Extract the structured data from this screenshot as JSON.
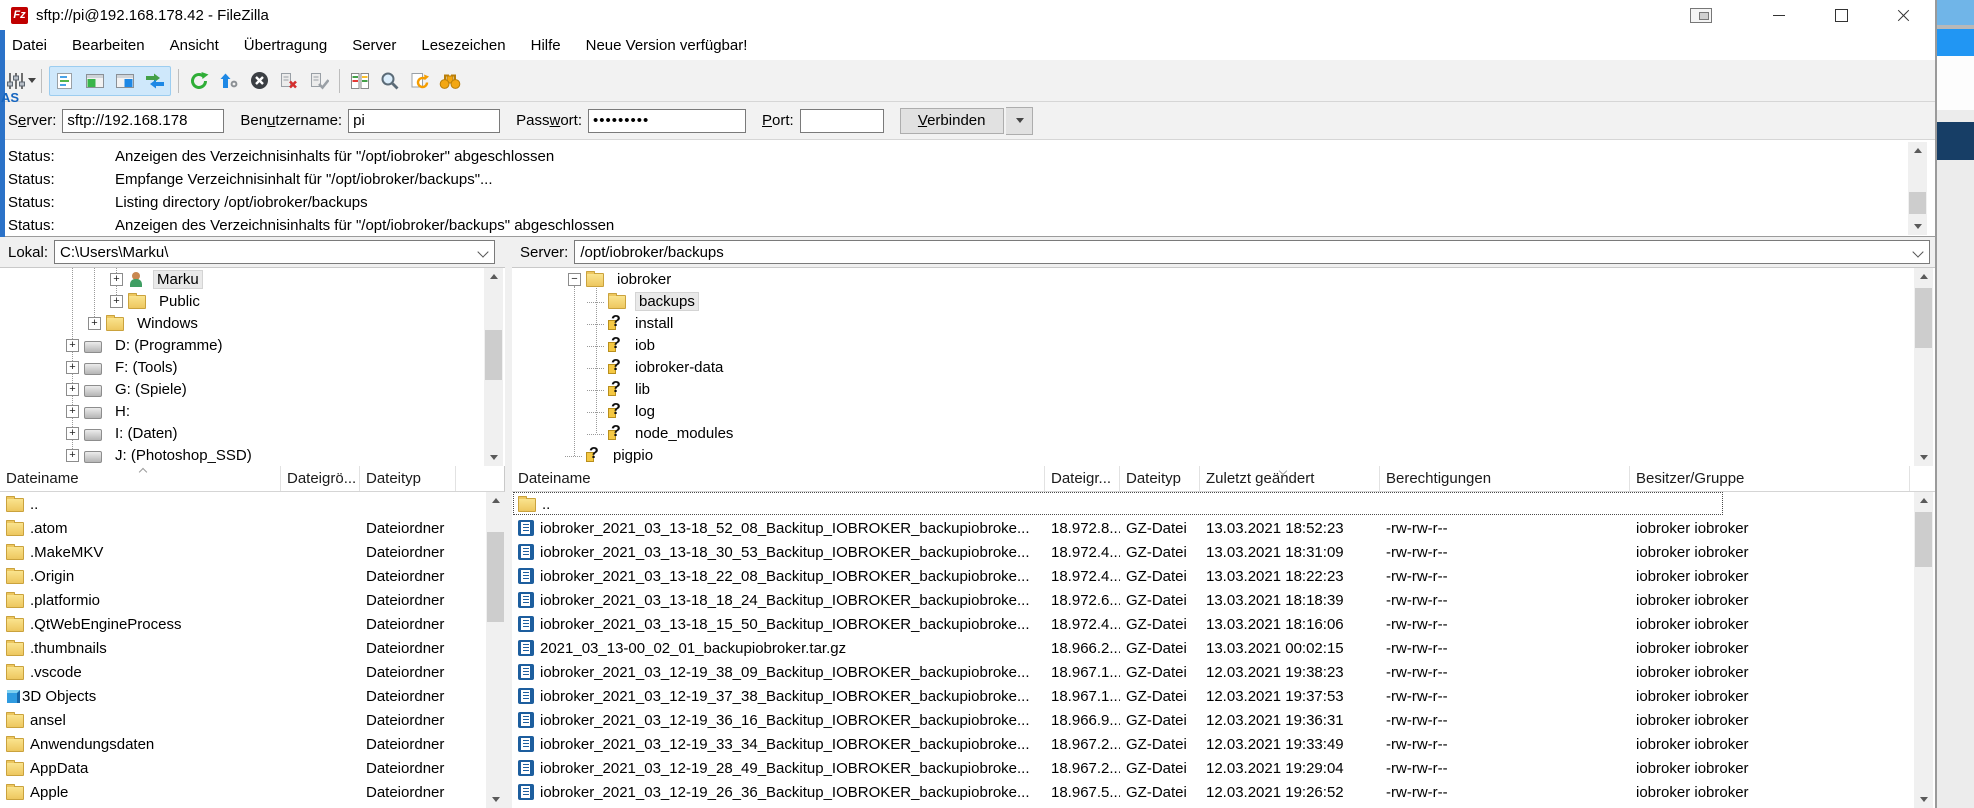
{
  "window": {
    "title": "sftp://pi@192.168.178.42 - FileZilla",
    "logo_text": "Fz"
  },
  "background": {
    "fragment_text": "AS"
  },
  "menu": {
    "items": [
      "Datei",
      "Bearbeiten",
      "Ansicht",
      "Übertragung",
      "Server",
      "Lesezeichen",
      "Hilfe",
      "Neue Version verfügbar!"
    ]
  },
  "toolbar": {
    "icons": [
      "site-manager",
      "toggle-message-log",
      "toggle-local-tree",
      "toggle-remote-tree",
      "toggle-transfer-queue",
      "refresh",
      "process-queue",
      "cancel-transfer",
      "disconnect",
      "reconnect",
      "directory-comparison",
      "synchronized-browsing",
      "refresh-directory-listing",
      "file-search"
    ]
  },
  "quickconnect": {
    "server_label_pre": "S",
    "server_label_key": "e",
    "server_label_post": "rver:",
    "server_value": "sftp://192.168.178",
    "user_label_pre": "Ben",
    "user_label_key": "u",
    "user_label_post": "tzername:",
    "user_value": "pi",
    "pass_label_pre": "Pass",
    "pass_label_key": "w",
    "pass_label_post": "ort:",
    "pass_value": "•••••••••",
    "port_label_pre": "",
    "port_label_key": "P",
    "port_label_post": "ort:",
    "port_value": "",
    "connect_key": "V",
    "connect_rest": "erbinden"
  },
  "status_log": [
    {
      "label": "Status:",
      "message": "Anzeigen des Verzeichnisinhalts für \"/opt/iobroker\" abgeschlossen"
    },
    {
      "label": "Status:",
      "message": "Empfange Verzeichnisinhalt für \"/opt/iobroker/backups\"..."
    },
    {
      "label": "Status:",
      "message": "Listing directory /opt/iobroker/backups"
    },
    {
      "label": "Status:",
      "message": "Anzeigen des Verzeichnisinhalts für \"/opt/iobroker/backups\" abgeschlossen"
    }
  ],
  "local": {
    "path_label": "Lokal:",
    "path_value": "C:\\Users\\Marku\\",
    "tree": [
      {
        "depth": 4,
        "expander": "plus",
        "icon": "user",
        "label": "Marku",
        "selected": true
      },
      {
        "depth": 4,
        "expander": "plus",
        "icon": "folder",
        "label": "Public",
        "selected": false
      },
      {
        "depth": 3,
        "expander": "plus",
        "icon": "folder",
        "label": "Windows",
        "selected": false
      },
      {
        "depth": 2,
        "expander": "plus",
        "icon": "drive",
        "label": "D: (Programme)",
        "selected": false
      },
      {
        "depth": 2,
        "expander": "plus",
        "icon": "drive",
        "label": "F: (Tools)",
        "selected": false
      },
      {
        "depth": 2,
        "expander": "plus",
        "icon": "drive",
        "label": "G: (Spiele)",
        "selected": false
      },
      {
        "depth": 2,
        "expander": "plus",
        "icon": "drive",
        "label": "H:",
        "selected": false
      },
      {
        "depth": 2,
        "expander": "plus",
        "icon": "drive",
        "label": "I: (Daten)",
        "selected": false
      },
      {
        "depth": 2,
        "expander": "plus",
        "icon": "drive",
        "label": "J: (Photoshop_SSD)",
        "selected": false
      }
    ],
    "columns": [
      "Dateiname",
      "Dateigrö...",
      "Dateityp"
    ],
    "rows": [
      {
        "icon": "folder",
        "name": "..",
        "size": "",
        "type": ""
      },
      {
        "icon": "folder",
        "name": ".atom",
        "size": "",
        "type": "Dateiordner"
      },
      {
        "icon": "folder",
        "name": ".MakeMKV",
        "size": "",
        "type": "Dateiordner"
      },
      {
        "icon": "folder",
        "name": ".Origin",
        "size": "",
        "type": "Dateiordner"
      },
      {
        "icon": "folder",
        "name": ".platformio",
        "size": "",
        "type": "Dateiordner"
      },
      {
        "icon": "folder",
        "name": ".QtWebEngineProcess",
        "size": "",
        "type": "Dateiordner"
      },
      {
        "icon": "folder",
        "name": ".thumbnails",
        "size": "",
        "type": "Dateiordner"
      },
      {
        "icon": "folder",
        "name": ".vscode",
        "size": "",
        "type": "Dateiordner"
      },
      {
        "icon": "cube",
        "name": "3D Objects",
        "size": "",
        "type": "Dateiordner"
      },
      {
        "icon": "folder",
        "name": "ansel",
        "size": "",
        "type": "Dateiordner"
      },
      {
        "icon": "folder",
        "name": "Anwendungsdaten",
        "size": "",
        "type": "Dateiordner"
      },
      {
        "icon": "folder",
        "name": "AppData",
        "size": "",
        "type": "Dateiordner"
      },
      {
        "icon": "folder",
        "name": "Apple",
        "size": "",
        "type": "Dateiordner"
      }
    ]
  },
  "remote": {
    "path_label": "Server:",
    "path_value": "/opt/iobroker/backups",
    "tree": [
      {
        "depth": 2,
        "expander": "minus",
        "icon": "folder",
        "label": "iobroker",
        "selected": false
      },
      {
        "depth": 3,
        "expander": "none",
        "icon": "folder",
        "label": "backups",
        "selected": true
      },
      {
        "depth": 3,
        "expander": "none",
        "icon": "question",
        "label": "install",
        "selected": false
      },
      {
        "depth": 3,
        "expander": "none",
        "icon": "question",
        "label": "iob",
        "selected": false
      },
      {
        "depth": 3,
        "expander": "none",
        "icon": "question",
        "label": "iobroker-data",
        "selected": false
      },
      {
        "depth": 3,
        "expander": "none",
        "icon": "question",
        "label": "lib",
        "selected": false
      },
      {
        "depth": 3,
        "expander": "none",
        "icon": "question",
        "label": "log",
        "selected": false
      },
      {
        "depth": 3,
        "expander": "none",
        "icon": "question",
        "label": "node_modules",
        "selected": false
      },
      {
        "depth": 2,
        "expander": "none",
        "icon": "question",
        "label": "pigpio",
        "selected": false
      }
    ],
    "columns": [
      "Dateiname",
      "Dateigr...",
      "Dateityp",
      "Zuletzt geändert",
      "Berechtigungen",
      "Besitzer/Gruppe"
    ],
    "rows": [
      {
        "icon": "folder",
        "name": "..",
        "size": "",
        "type": "",
        "modified": "",
        "perms": "",
        "owner": "",
        "focus": true
      },
      {
        "icon": "gz",
        "name": "iobroker_2021_03_13-18_52_08_Backitup_IOBROKER_backupiobroke...",
        "size": "18.972.8...",
        "type": "GZ-Datei",
        "modified": "13.03.2021 18:52:23",
        "perms": "-rw-rw-r--",
        "owner": "iobroker iobroker",
        "focus": false
      },
      {
        "icon": "gz",
        "name": "iobroker_2021_03_13-18_30_53_Backitup_IOBROKER_backupiobroke...",
        "size": "18.972.4...",
        "type": "GZ-Datei",
        "modified": "13.03.2021 18:31:09",
        "perms": "-rw-rw-r--",
        "owner": "iobroker iobroker",
        "focus": false
      },
      {
        "icon": "gz",
        "name": "iobroker_2021_03_13-18_22_08_Backitup_IOBROKER_backupiobroke...",
        "size": "18.972.4...",
        "type": "GZ-Datei",
        "modified": "13.03.2021 18:22:23",
        "perms": "-rw-rw-r--",
        "owner": "iobroker iobroker",
        "focus": false
      },
      {
        "icon": "gz",
        "name": "iobroker_2021_03_13-18_18_24_Backitup_IOBROKER_backupiobroke...",
        "size": "18.972.6...",
        "type": "GZ-Datei",
        "modified": "13.03.2021 18:18:39",
        "perms": "-rw-rw-r--",
        "owner": "iobroker iobroker",
        "focus": false
      },
      {
        "icon": "gz",
        "name": "iobroker_2021_03_13-18_15_50_Backitup_IOBROKER_backupiobroke...",
        "size": "18.972.4...",
        "type": "GZ-Datei",
        "modified": "13.03.2021 18:16:06",
        "perms": "-rw-rw-r--",
        "owner": "iobroker iobroker",
        "focus": false
      },
      {
        "icon": "gz",
        "name": "2021_03_13-00_02_01_backupiobroker.tar.gz",
        "size": "18.966.2...",
        "type": "GZ-Datei",
        "modified": "13.03.2021 00:02:15",
        "perms": "-rw-rw-r--",
        "owner": "iobroker iobroker",
        "focus": false
      },
      {
        "icon": "gz",
        "name": "iobroker_2021_03_12-19_38_09_Backitup_IOBROKER_backupiobroke...",
        "size": "18.967.1...",
        "type": "GZ-Datei",
        "modified": "12.03.2021 19:38:23",
        "perms": "-rw-rw-r--",
        "owner": "iobroker iobroker",
        "focus": false
      },
      {
        "icon": "gz",
        "name": "iobroker_2021_03_12-19_37_38_Backitup_IOBROKER_backupiobroke...",
        "size": "18.967.1...",
        "type": "GZ-Datei",
        "modified": "12.03.2021 19:37:53",
        "perms": "-rw-rw-r--",
        "owner": "iobroker iobroker",
        "focus": false
      },
      {
        "icon": "gz",
        "name": "iobroker_2021_03_12-19_36_16_Backitup_IOBROKER_backupiobroke...",
        "size": "18.966.9...",
        "type": "GZ-Datei",
        "modified": "12.03.2021 19:36:31",
        "perms": "-rw-rw-r--",
        "owner": "iobroker iobroker",
        "focus": false
      },
      {
        "icon": "gz",
        "name": "iobroker_2021_03_12-19_33_34_Backitup_IOBROKER_backupiobroke...",
        "size": "18.967.2...",
        "type": "GZ-Datei",
        "modified": "12.03.2021 19:33:49",
        "perms": "-rw-rw-r--",
        "owner": "iobroker iobroker",
        "focus": false
      },
      {
        "icon": "gz",
        "name": "iobroker_2021_03_12-19_28_49_Backitup_IOBROKER_backupiobroke...",
        "size": "18.967.2...",
        "type": "GZ-Datei",
        "modified": "12.03.2021 19:29:04",
        "perms": "-rw-rw-r--",
        "owner": "iobroker iobroker",
        "focus": false
      },
      {
        "icon": "gz",
        "name": "iobroker_2021_03_12-19_26_36_Backitup_IOBROKER_backupiobroke...",
        "size": "18.967.5...",
        "type": "GZ-Datei",
        "modified": "12.03.2021 19:26:52",
        "perms": "-rw-rw-r--",
        "owner": "iobroker iobroker",
        "focus": false
      }
    ]
  },
  "colors": {
    "accent_blue": "#2b9af3",
    "selection_gray": "#e9e9e9",
    "toolbar_pressed": "#cfe8fb",
    "folder_yellow": "#edc75f",
    "gz_blue": "#1d5e9e",
    "edge_blue": "#2b72c8"
  }
}
